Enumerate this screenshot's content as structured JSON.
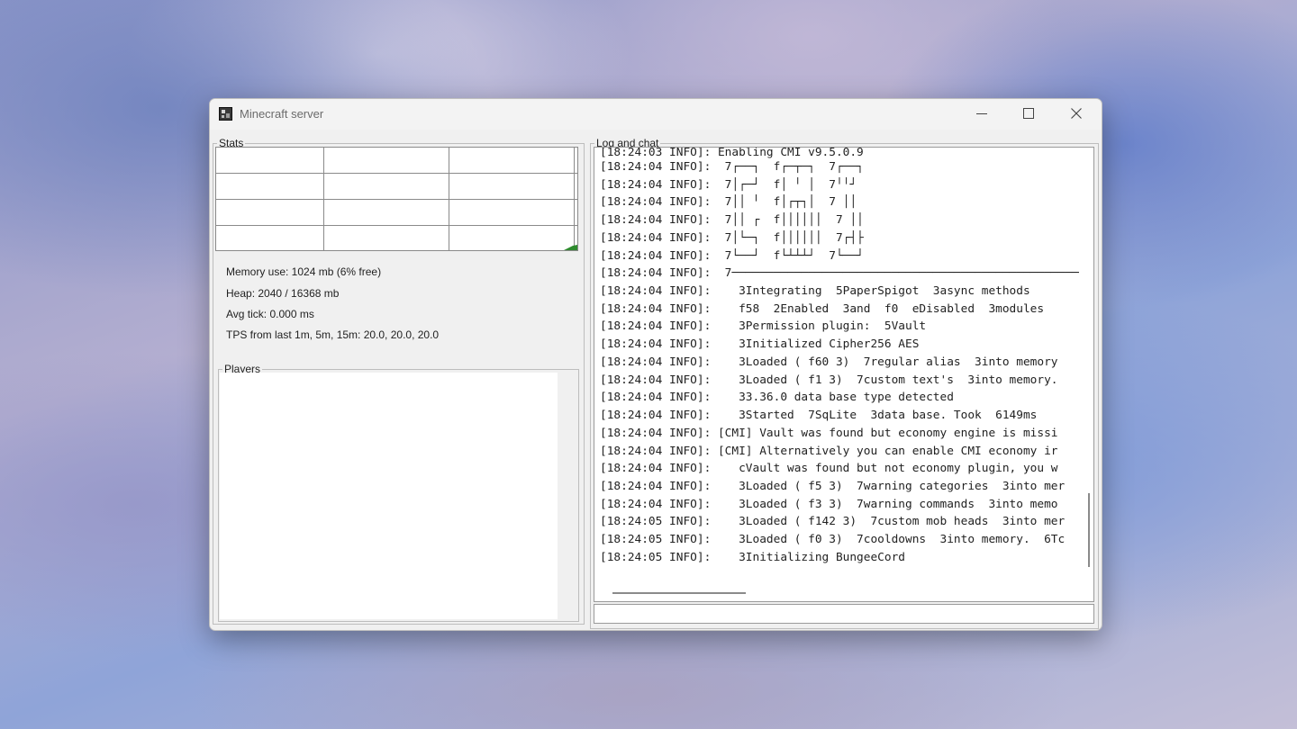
{
  "window": {
    "title": "Minecraft server",
    "icon": "minecraft-server-icon",
    "controls": [
      "minimize-icon",
      "maximize-icon",
      "close-icon"
    ]
  },
  "stats": {
    "legend": "Stats",
    "memory_use": "Memory use: 1024 mb (6% free)",
    "heap": "Heap: 2040 / 16368 mb",
    "avg_tick": "Avg tick: 0.000 ms",
    "tps": "TPS from last 1m, 5m, 15m: 20.0, 20.0, 20.0",
    "graph_color": "#2e8b2e"
  },
  "players": {
    "legend": "Players",
    "items": []
  },
  "log": {
    "legend": "Log and chat",
    "lines": [
      "[18:24:03 INFO]: Enabling CMI v9.5.0.9",
      "[18:24:04 INFO]:  7┌──┐  f┌─┬─┐  7┌──┐",
      "[18:24:04 INFO]:  7│┌─┘  f│ ╵ │  7╵╵┘",
      "[18:24:04 INFO]:  7││ ╵  f│┌┬┐│  7 ││",
      "[18:24:04 INFO]:  7││ ┌  f││││││  7 ││",
      "[18:24:04 INFO]:  7│└─┐  f││││││  7┌┤├",
      "[18:24:04 INFO]:  7└──┘  f└┴┴┴┘  7└──┘",
      "[18:24:04 INFO]:  7────────────────────────────────────────────────────",
      "[18:24:04 INFO]:    3Integrating  5PaperSpigot  3async methods",
      "[18:24:04 INFO]:    f58  2Enabled  3and  f0  eDisabled  3modules",
      "[18:24:04 INFO]:    3Permission plugin:  5Vault",
      "[18:24:04 INFO]:    3Initialized Cipher256 AES",
      "[18:24:04 INFO]:    3Loaded ( f60 3)  7regular alias  3into memory",
      "[18:24:04 INFO]:    3Loaded ( f1 3)  7custom text's  3into memory.",
      "[18:24:04 INFO]:    33.36.0 data base type detected",
      "[18:24:04 INFO]:    3Started  7SqLite  3data base. Took  6149ms",
      "[18:24:04 INFO]: [CMI] Vault was found but economy engine is missi",
      "[18:24:04 INFO]: [CMI] Alternatively you can enable CMI economy ir",
      "[18:24:04 INFO]:    cVault was found but not economy plugin, you w",
      "[18:24:04 INFO]:    3Loaded ( f5 3)  7warning categories  3into mer",
      "[18:24:04 INFO]:    3Loaded ( f3 3)  7warning commands  3into memo",
      "[18:24:05 INFO]:    3Loaded ( f142 3)  7custom mob heads  3into mer",
      "[18:24:05 INFO]:    3Loaded ( f0 3)  7cooldowns  3into memory.  6Tc",
      "[18:24:05 INFO]:    3Initializing BungeeCord"
    ],
    "chat_input_value": ""
  }
}
